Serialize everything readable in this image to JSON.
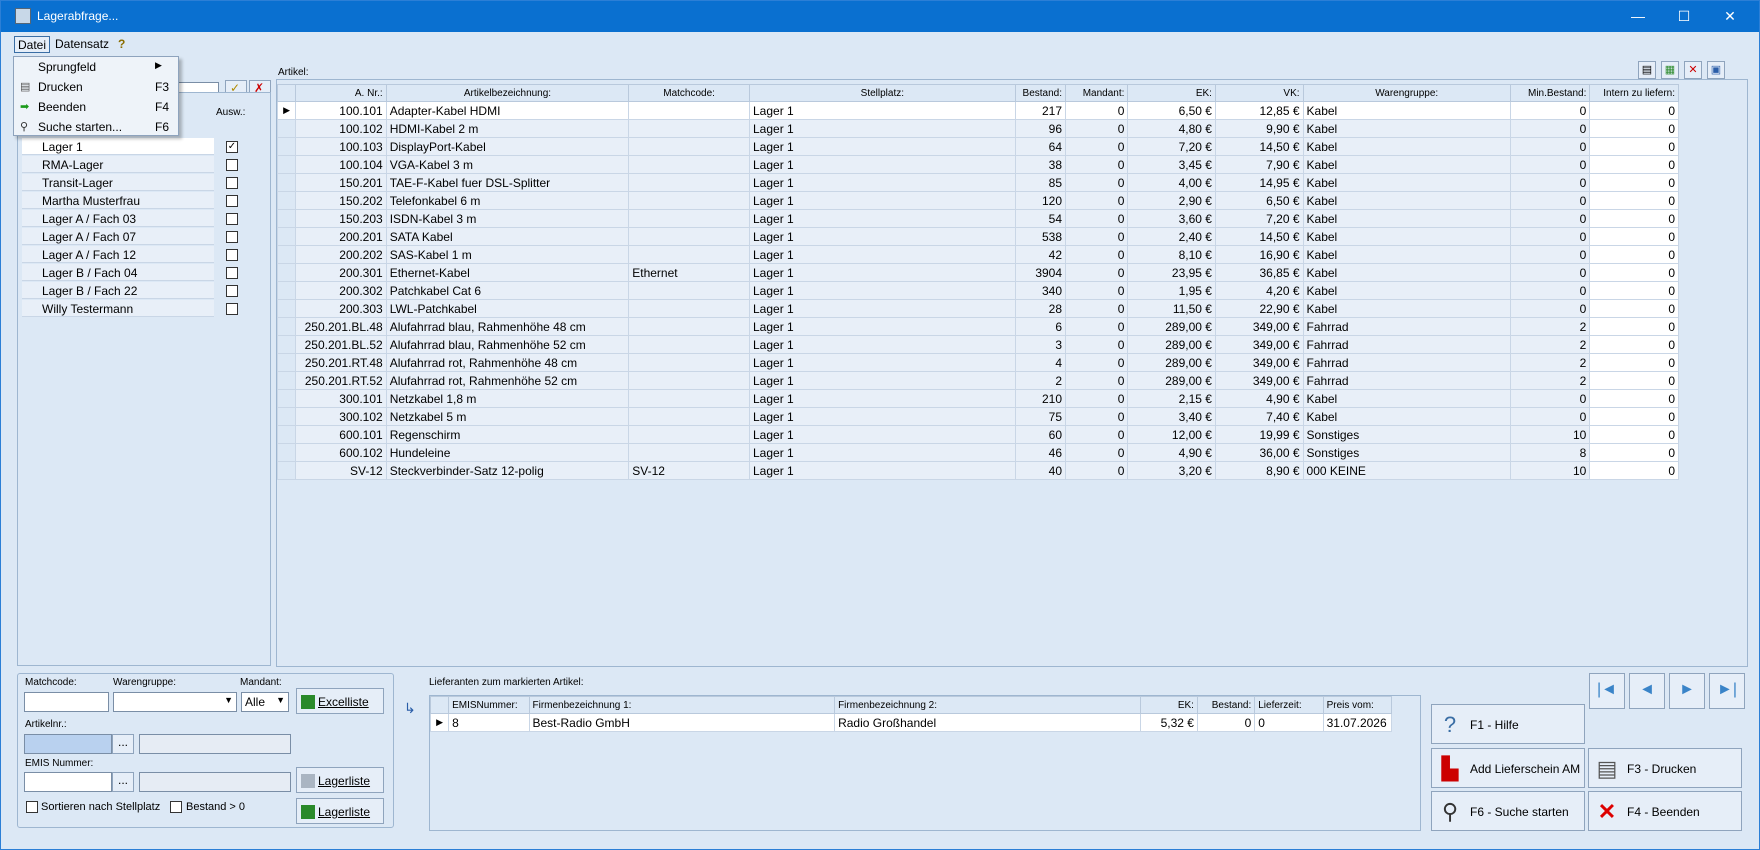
{
  "window": {
    "title": "Lagerabfrage...",
    "minimize": "—",
    "maximize": "☐",
    "close": "✕"
  },
  "menu": {
    "datei": "Datei",
    "datensatz": "Datensatz",
    "help_icon": "?"
  },
  "dropdown": [
    {
      "label": "Sprungfeld",
      "key": "",
      "icon": "arrow-right-submenu"
    },
    {
      "label": "Drucken",
      "key": "F3",
      "icon": "printer-icon"
    },
    {
      "label": "Beenden",
      "key": "F4",
      "icon": "green-arrow-icon"
    },
    {
      "label": "Suche starten...",
      "key": "F6",
      "icon": "magnifier-icon"
    }
  ],
  "storage": {
    "header_ausw": "Ausw.:",
    "partial_label": "Lager 1",
    "items": [
      {
        "name": "RMA-Lager",
        "checked": false
      },
      {
        "name": "Transit-Lager",
        "checked": false
      },
      {
        "name": "Martha Musterfrau",
        "checked": false
      },
      {
        "name": "Lager A / Fach 03",
        "checked": false
      },
      {
        "name": "Lager A / Fach 07",
        "checked": false
      },
      {
        "name": "Lager A / Fach 12",
        "checked": false
      },
      {
        "name": "Lager B / Fach 04",
        "checked": false
      },
      {
        "name": "Lager B / Fach 22",
        "checked": false
      },
      {
        "name": "Willy Testermann",
        "checked": false
      }
    ]
  },
  "articles": {
    "label": "Artikel:",
    "columns": [
      "A. Nr.:",
      "Artikelbezeichnung:",
      "Matchcode:",
      "Stellplatz:",
      "Bestand:",
      "Mandant:",
      "EK:",
      "VK:",
      "Warengruppe:",
      "Min.Bestand:",
      "Intern zu liefern:"
    ],
    "rows": [
      [
        "100.101",
        "Adapter-Kabel HDMI",
        "",
        "Lager 1",
        "217",
        "0",
        "6,50 €",
        "12,85 €",
        "Kabel",
        "0",
        "0"
      ],
      [
        "100.102",
        "HDMI-Kabel 2 m",
        "",
        "Lager 1",
        "96",
        "0",
        "4,80 €",
        "9,90 €",
        "Kabel",
        "0",
        "0"
      ],
      [
        "100.103",
        "DisplayPort-Kabel",
        "",
        "Lager 1",
        "64",
        "0",
        "7,20 €",
        "14,50 €",
        "Kabel",
        "0",
        "0"
      ],
      [
        "100.104",
        "VGA-Kabel 3 m",
        "",
        "Lager 1",
        "38",
        "0",
        "3,45 €",
        "7,90 €",
        "Kabel",
        "0",
        "0"
      ],
      [
        "150.201",
        "TAE-F-Kabel fuer DSL-Splitter",
        "",
        "Lager 1",
        "85",
        "0",
        "4,00 €",
        "14,95 €",
        "Kabel",
        "0",
        "0"
      ],
      [
        "150.202",
        "Telefonkabel 6 m",
        "",
        "Lager 1",
        "120",
        "0",
        "2,90 €",
        "6,50 €",
        "Kabel",
        "0",
        "0"
      ],
      [
        "150.203",
        "ISDN-Kabel 3 m",
        "",
        "Lager 1",
        "54",
        "0",
        "3,60 €",
        "7,20 €",
        "Kabel",
        "0",
        "0"
      ],
      [
        "200.201",
        "SATA Kabel",
        "",
        "Lager 1",
        "538",
        "0",
        "2,40 €",
        "14,50 €",
        "Kabel",
        "0",
        "0"
      ],
      [
        "200.202",
        "SAS-Kabel 1 m",
        "",
        "Lager 1",
        "42",
        "0",
        "8,10 €",
        "16,90 €",
        "Kabel",
        "0",
        "0"
      ],
      [
        "200.301",
        "Ethernet-Kabel",
        "Ethernet",
        "Lager 1",
        "3904",
        "0",
        "23,95 €",
        "36,85 €",
        "Kabel",
        "0",
        "0"
      ],
      [
        "200.302",
        "Patchkabel Cat 6",
        "",
        "Lager 1",
        "340",
        "0",
        "1,95 €",
        "4,20 €",
        "Kabel",
        "0",
        "0"
      ],
      [
        "200.303",
        "LWL-Patchkabel",
        "",
        "Lager 1",
        "28",
        "0",
        "11,50 €",
        "22,90 €",
        "Kabel",
        "0",
        "0"
      ],
      [
        "250.201.BL.48",
        "Alufahrrad blau, Rahmenhöhe 48 cm",
        "",
        "Lager 1",
        "6",
        "0",
        "289,00 €",
        "349,00 €",
        "Fahrrad",
        "2",
        "0"
      ],
      [
        "250.201.BL.52",
        "Alufahrrad blau, Rahmenhöhe 52 cm",
        "",
        "Lager 1",
        "3",
        "0",
        "289,00 €",
        "349,00 €",
        "Fahrrad",
        "2",
        "0"
      ],
      [
        "250.201.RT.48",
        "Alufahrrad rot, Rahmenhöhe 48 cm",
        "",
        "Lager 1",
        "4",
        "0",
        "289,00 €",
        "349,00 €",
        "Fahrrad",
        "2",
        "0"
      ],
      [
        "250.201.RT.52",
        "Alufahrrad rot, Rahmenhöhe 52 cm",
        "",
        "Lager 1",
        "2",
        "0",
        "289,00 €",
        "349,00 €",
        "Fahrrad",
        "2",
        "0"
      ],
      [
        "300.101",
        "Netzkabel 1,8 m",
        "",
        "Lager 1",
        "210",
        "0",
        "2,15 €",
        "4,90 €",
        "Kabel",
        "0",
        "0"
      ],
      [
        "300.102",
        "Netzkabel 5 m",
        "",
        "Lager 1",
        "75",
        "0",
        "3,40 €",
        "7,40 €",
        "Kabel",
        "0",
        "0"
      ],
      [
        "600.101",
        "Regenschirm",
        "",
        "Lager 1",
        "60",
        "0",
        "12,00 €",
        "19,99 €",
        "Sonstiges",
        "10",
        "0"
      ],
      [
        "600.102",
        "Hundeleine",
        "",
        "Lager 1",
        "46",
        "0",
        "4,90 €",
        "36,00 €",
        "Sonstiges",
        "8",
        "0"
      ],
      [
        "SV-12",
        "Steckverbinder-Satz 12-polig",
        "SV-12",
        "Lager 1",
        "40",
        "0",
        "3,20 €",
        "8,90 €",
        "000 KEINE",
        "10",
        "0"
      ]
    ]
  },
  "filter": {
    "matchcode_label": "Matchcode:",
    "warengruppe_label": "Warengruppe:",
    "mandant_label": "Mandant:",
    "mandant_value": "Alle",
    "artikelnr_label": "Artikelnr.:",
    "emis_label": "EMIS Nummer:",
    "dots": "...",
    "excelliste": "Excelliste",
    "lagerliste1": "Lagerliste",
    "lagerliste2": "Lagerliste",
    "sort_label": "Sortieren nach Stellplatz",
    "bestand_label": "Bestand > 0"
  },
  "suppliers": {
    "label": "Lieferanten zum markierten Artikel:",
    "columns": [
      "EMISNummer:",
      "Firmenbezeichnung 1:",
      "Firmenbezeichnung 2:",
      "EK:",
      "Bestand:",
      "Lieferzeit:",
      "Preis vom:"
    ],
    "rows": [
      [
        "8",
        "Best-Radio GmbH",
        "Radio Großhandel",
        "5,32 €",
        "0",
        "0",
        "31.07.2026"
      ]
    ]
  },
  "buttons": {
    "help": "F1 - Hilfe",
    "add_lieferschein": "Add Lieferschein AM",
    "print": "F3 - Drucken",
    "search": "F6 - Suche starten",
    "quit": "F4 - Beenden",
    "nav_first": "|◄",
    "nav_prev": "◄",
    "nav_next": "►",
    "nav_last": "►|"
  }
}
